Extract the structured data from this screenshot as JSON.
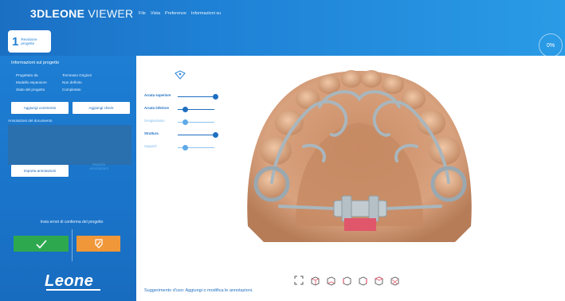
{
  "app": {
    "brand_bold": "3DLEONE",
    "brand_light": " VIEWER"
  },
  "menu": [
    "File",
    "Vista",
    "Preferenze",
    "Informazioni su"
  ],
  "progress": {
    "label": "0%"
  },
  "step": {
    "number": "1",
    "label": "Revisione progetto"
  },
  "project": {
    "section_title": "Informazioni sul progetto",
    "rows": [
      {
        "key": "Progettato da",
        "value": "Tommaso Grigioni"
      },
      {
        "key": "Modello espansore",
        "value": "Non definito"
      },
      {
        "key": "Stato del progetto",
        "value": "Completato"
      }
    ]
  },
  "buttons": {
    "add_comments": "Aggiungi commento",
    "add_check": "Aggiungi check",
    "import_annotations": "Importa annotazioni",
    "export_annotations": "Esporta annotazioni"
  },
  "annotations": {
    "label": "Annotazioni del documento"
  },
  "confirm": {
    "text": "Invia errori di conferma del progetto"
  },
  "logo": {
    "text": "Leone"
  },
  "sliders": [
    {
      "label": "Arcata superiore",
      "value": 0.95,
      "dim": false
    },
    {
      "label": "Arcata inferiore",
      "value": 0.12,
      "dim": false
    },
    {
      "label": "Gengiva/osso",
      "value": 0.12,
      "dim": true
    },
    {
      "label": "Struttura",
      "value": 0.95,
      "dim": false
    },
    {
      "label": "Supporti",
      "value": 0.12,
      "dim": true
    }
  ],
  "toolbar_icons": [
    "fit-view-icon",
    "view-front-icon",
    "view-back-icon",
    "view-left-icon",
    "view-right-icon",
    "view-top-icon",
    "view-bottom-icon"
  ],
  "hint": {
    "text": "Suggerimento d'uso: Aggiungi o modifica le annotazioni."
  },
  "colors": {
    "header": "#1f82d6",
    "panel": "#1a74c9",
    "ok": "#2ea84f",
    "warn": "#f0973a",
    "model": "#d9a27e",
    "metal": "#a9b6bd",
    "marker": "#e0566b"
  }
}
